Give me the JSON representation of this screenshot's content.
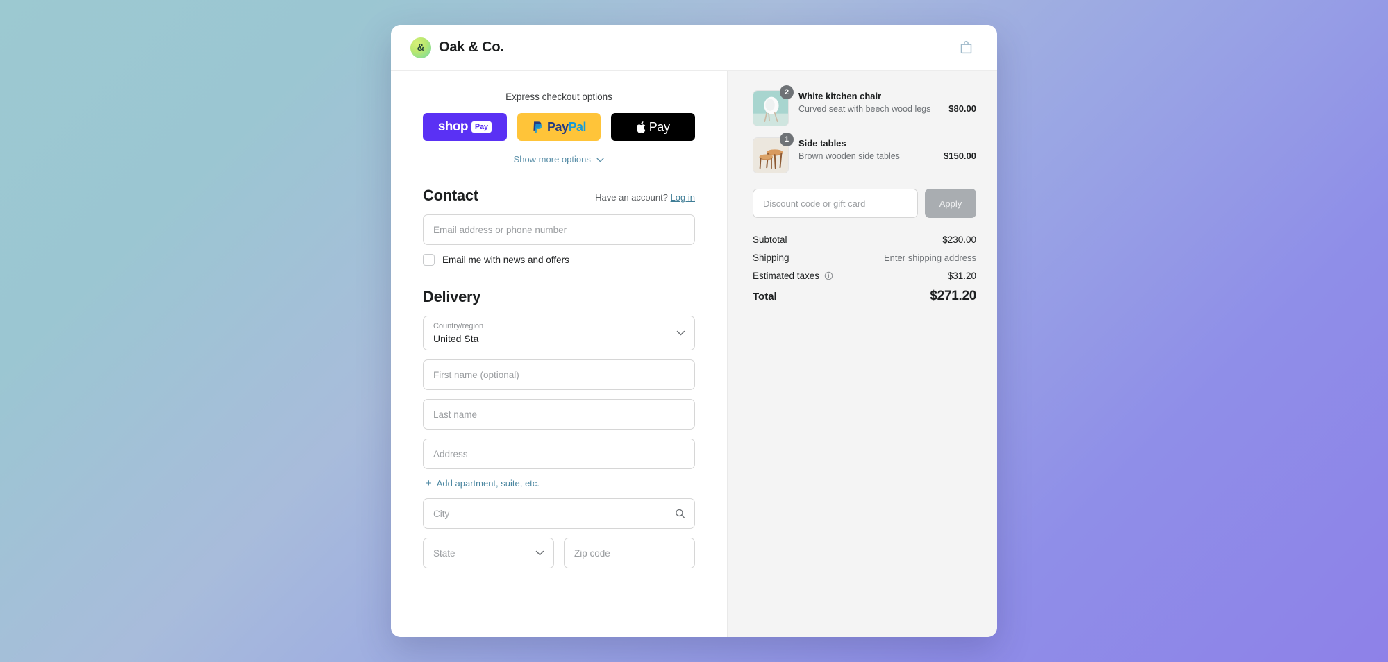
{
  "header": {
    "logo_letter": "&",
    "brand": "Oak & Co.",
    "cart_icon": "shopping-bag-icon"
  },
  "express": {
    "label": "Express checkout options",
    "buttons": [
      {
        "id": "shop-pay",
        "word": "shop",
        "badge": "Pay",
        "bg": "#5a31f4"
      },
      {
        "id": "paypal",
        "pay": "Pay",
        "pal": "Pal",
        "bg": "#ffc439"
      },
      {
        "id": "apple-pay",
        "label": "Pay",
        "bg": "#000000"
      }
    ],
    "show_more": "Show more options"
  },
  "contact": {
    "title": "Contact",
    "account_prompt": "Have an account?",
    "login_link": "Log in",
    "email_placeholder": "Email address or phone number",
    "newsletter_label": "Email me with news and offers",
    "newsletter_checked": false
  },
  "delivery": {
    "title": "Delivery",
    "country": {
      "label": "Country/region",
      "value": "United Sta"
    },
    "first_name_placeholder": "First name (optional)",
    "last_name_placeholder": "Last name",
    "address_placeholder": "Address",
    "add_apartment_link": "Add apartment, suite, etc.",
    "city_placeholder": "City",
    "state_placeholder": "State",
    "zip_placeholder": "Zip code"
  },
  "summary": {
    "products": [
      {
        "name": "White kitchen chair",
        "description": "Curved seat with beech wood legs",
        "price": "$80.00",
        "qty": "2",
        "thumb": "white-kitchen-chair-photo"
      },
      {
        "name": "Side tables",
        "description": "Brown wooden side tables",
        "price": "$150.00",
        "qty": "1",
        "thumb": "side-tables-photo"
      }
    ],
    "discount_placeholder": "Discount code or gift card",
    "apply_label": "Apply",
    "lines": [
      {
        "label": "Subtotal",
        "value": "$230.00",
        "muted": false
      },
      {
        "label": "Shipping",
        "value": "Enter shipping address",
        "muted": true
      },
      {
        "label": "Estimated taxes",
        "value": "$31.20",
        "muted": false,
        "info": true
      }
    ],
    "total_label": "Total",
    "total_value": "$271.20"
  },
  "colors": {
    "bg_start": "#9cc9d1",
    "bg_end": "#8e81e8",
    "shop_purple": "#5a31f4",
    "paypal_yellow": "#ffc439",
    "link_blue": "#4a86a0"
  }
}
